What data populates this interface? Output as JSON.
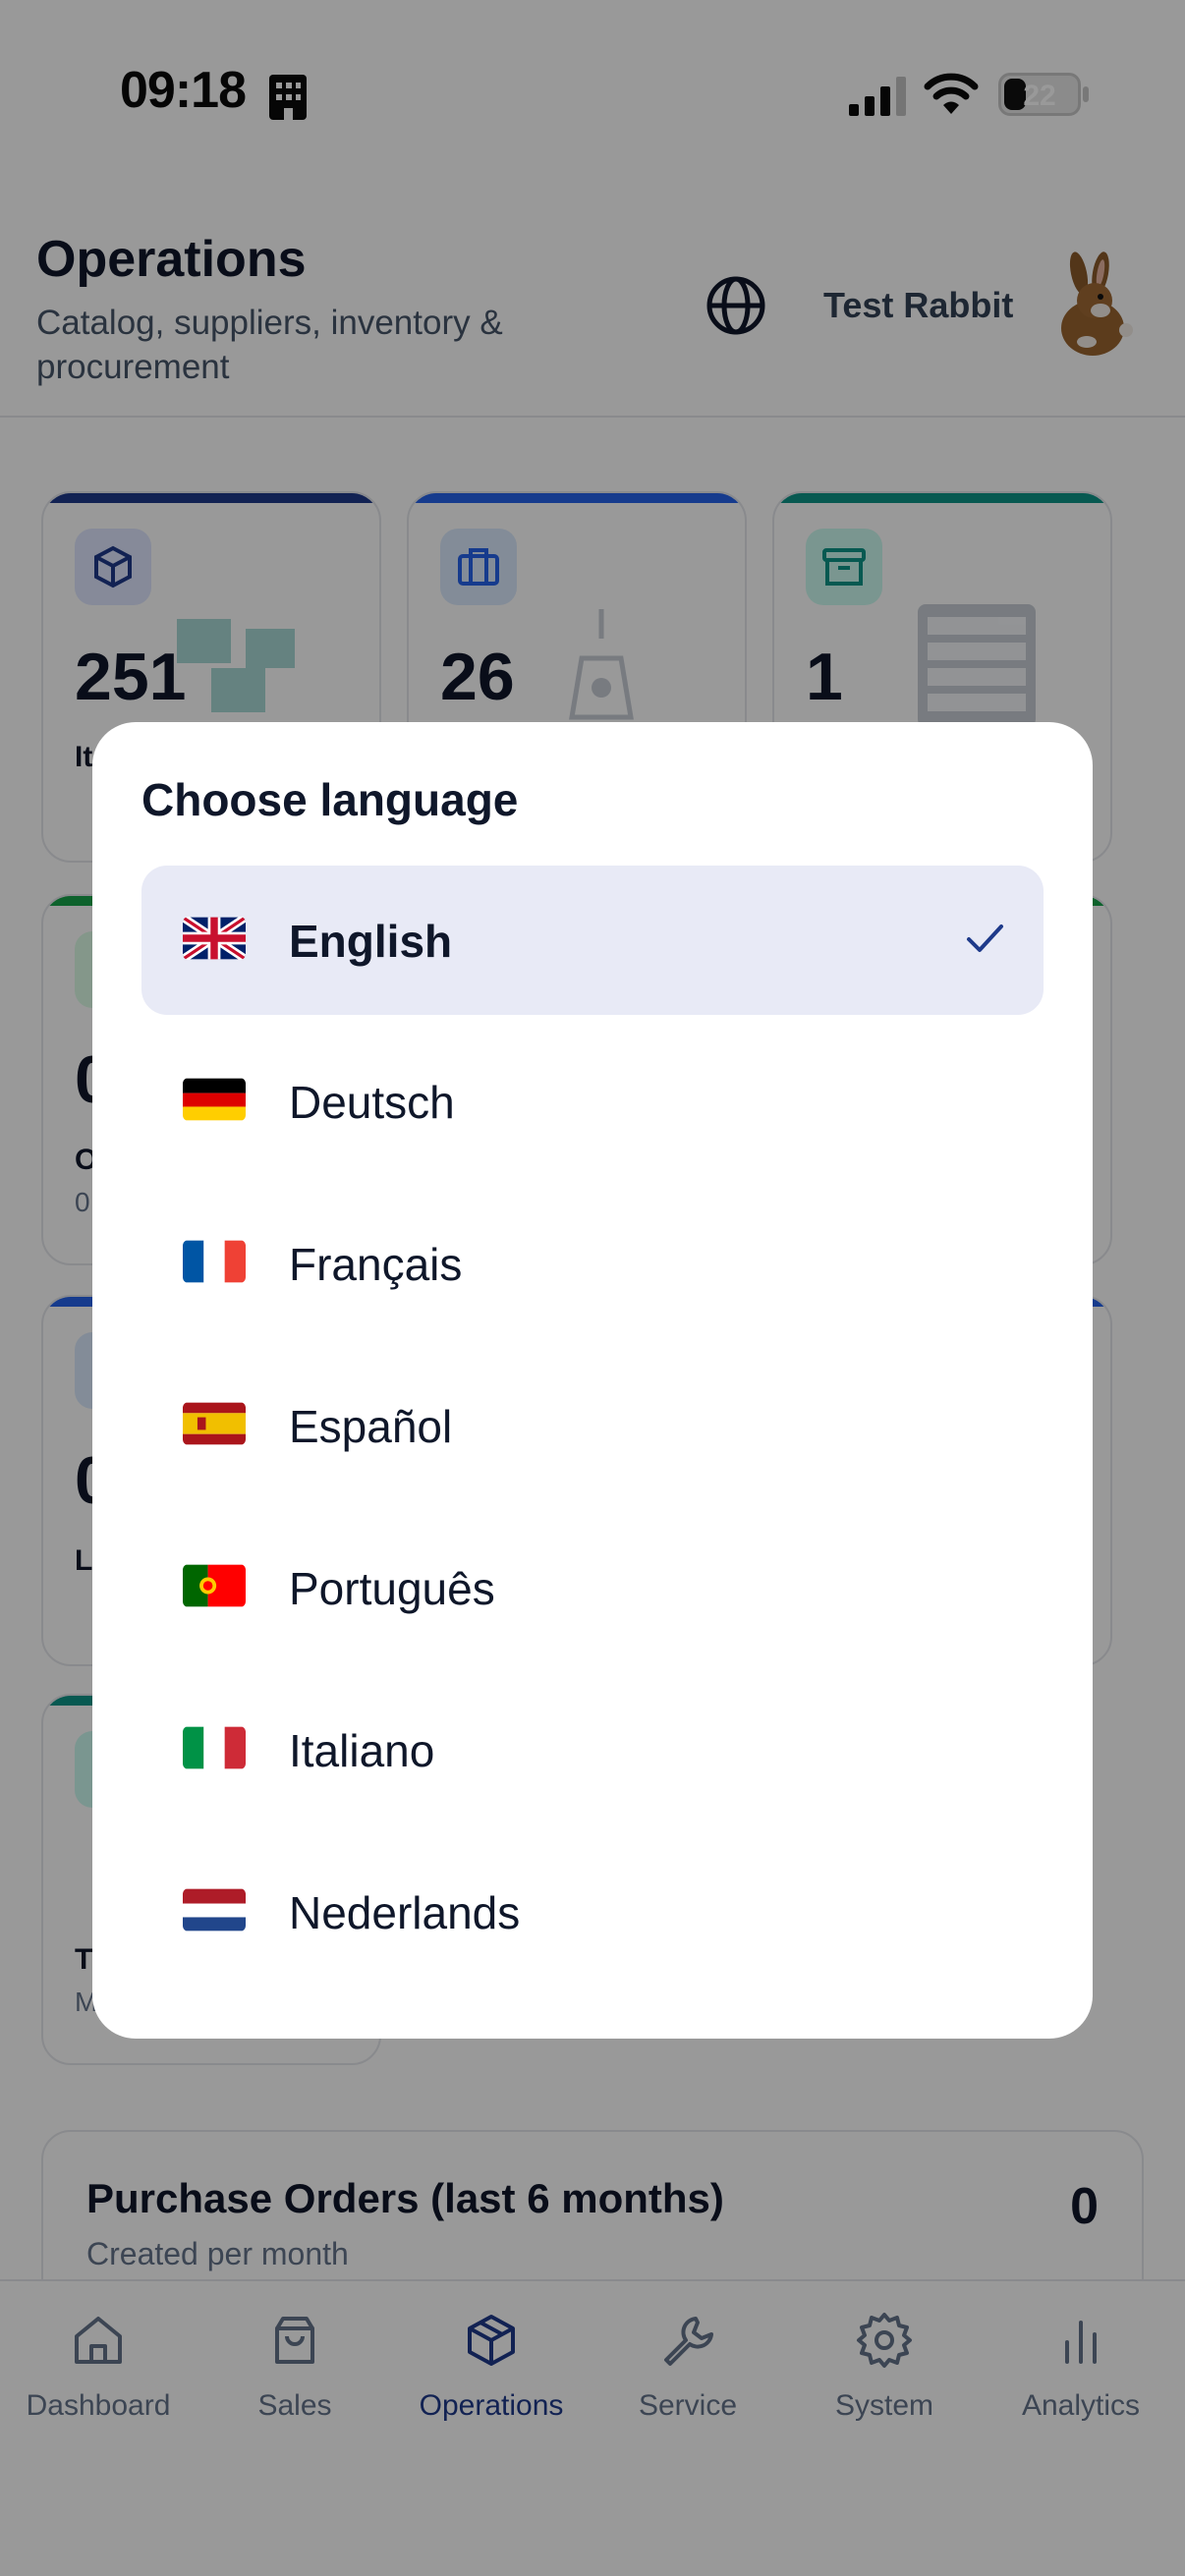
{
  "status_bar": {
    "time": "09:18",
    "battery": "22"
  },
  "header": {
    "title": "Operations",
    "subtitle": "Catalog, suppliers, inventory & procurement",
    "user_name": "Test Rabbit"
  },
  "cards": [
    {
      "value": "251",
      "label": "It",
      "accent": "#1e3a8a",
      "icon_bg": "#e0e7ff"
    },
    {
      "value": "26",
      "label": "",
      "accent": "#2563eb",
      "icon_bg": "#dbeafe"
    },
    {
      "value": "1",
      "label": "",
      "accent": "#0d9488",
      "icon_bg": "#ccfbf1"
    },
    {
      "value": "0",
      "label": "O",
      "sub": "0",
      "accent": "#16a34a",
      "icon_bg": "#dcfce7"
    },
    {
      "value": "0",
      "label": "L",
      "accent": "#2563eb",
      "icon_bg": "#dbeafe"
    },
    {
      "value": "",
      "label": "T",
      "sub": "M",
      "accent": "#0d9488",
      "icon_bg": "#ccfbf1"
    }
  ],
  "purchase_orders": {
    "title": "Purchase Orders (last 6 months)",
    "subtitle": "Created per month",
    "count": "0"
  },
  "tabs": [
    {
      "label": "Dashboard",
      "icon": "home-icon"
    },
    {
      "label": "Sales",
      "icon": "shopping-bag-icon"
    },
    {
      "label": "Operations",
      "icon": "package-icon",
      "active": true
    },
    {
      "label": "Service",
      "icon": "wrench-icon"
    },
    {
      "label": "System",
      "icon": "gear-icon"
    },
    {
      "label": "Analytics",
      "icon": "bar-chart-icon"
    }
  ],
  "modal": {
    "title": "Choose language",
    "languages": [
      {
        "label": "English",
        "flag": "uk-flag-icon",
        "selected": true
      },
      {
        "label": "Deutsch",
        "flag": "germany-flag-icon"
      },
      {
        "label": "Français",
        "flag": "france-flag-icon"
      },
      {
        "label": "Español",
        "flag": "spain-flag-icon"
      },
      {
        "label": "Português",
        "flag": "portugal-flag-icon"
      },
      {
        "label": "Italiano",
        "flag": "italy-flag-icon"
      },
      {
        "label": "Nederlands",
        "flag": "netherlands-flag-icon"
      }
    ]
  },
  "colors": {
    "accent": "#1e3a8a",
    "selected_bg": "#e8eaf6",
    "overlay": "rgba(0,0,0,0.40)"
  }
}
